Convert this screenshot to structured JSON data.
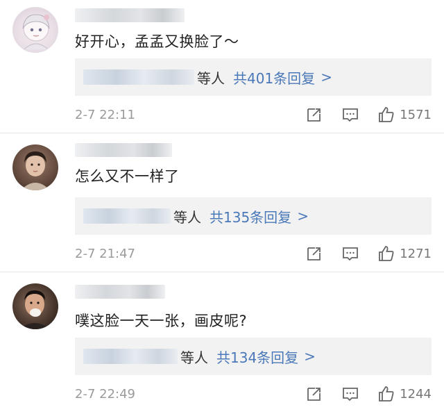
{
  "comments": [
    {
      "text": "好开心，孟孟又换脸了～",
      "reply_others": "等人",
      "reply_count": "共401条回复",
      "reply_chevron": ">",
      "timestamp": "2-7 22:11",
      "likes": "1571",
      "avatar_icon": "anime-girl-avatar"
    },
    {
      "text": "怎么又不一样了",
      "reply_others": "等人",
      "reply_count": "共135条回复",
      "reply_chevron": ">",
      "timestamp": "2-7 21:47",
      "likes": "1271",
      "avatar_icon": "person-photo-avatar"
    },
    {
      "text": "噗这脸一天一张，画皮呢?",
      "reply_others": "等人",
      "reply_count": "共134条回复",
      "reply_chevron": ">",
      "timestamp": "2-7 22:49",
      "likes": "1244",
      "avatar_icon": "person-photo-avatar"
    }
  ],
  "colors": {
    "link": "#4a78b8",
    "text": "#222222",
    "muted": "#9a9a9a",
    "reply_bg": "#f2f2f2"
  }
}
